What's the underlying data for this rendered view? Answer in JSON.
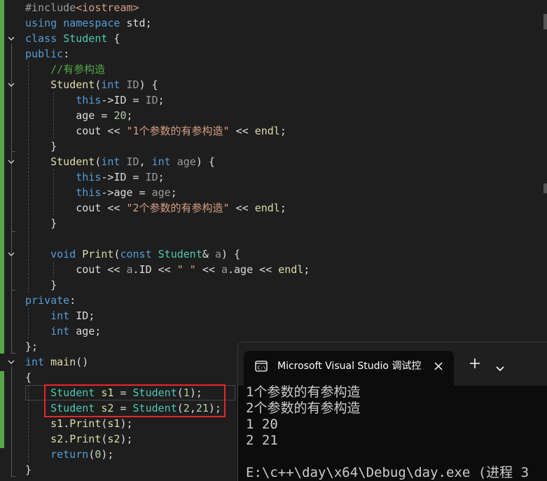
{
  "editor": {
    "lines": [
      [
        {
          "t": "#include",
          "c": "pp"
        },
        {
          "t": "<iostream>",
          "c": "st"
        }
      ],
      [
        {
          "t": "using",
          "c": "kw"
        },
        {
          "t": " ",
          "c": ""
        },
        {
          "t": "namespace",
          "c": "kw"
        },
        {
          "t": " std;",
          "c": ""
        }
      ],
      [
        {
          "t": "class",
          "c": "kw"
        },
        {
          "t": " ",
          "c": ""
        },
        {
          "t": "Student",
          "c": "ty"
        },
        {
          "t": " {",
          "c": ""
        }
      ],
      [
        {
          "t": "public",
          "c": "kw"
        },
        {
          "t": ":",
          "c": ""
        }
      ],
      [
        {
          "t": "    ",
          "c": ""
        },
        {
          "t": "//有参构造",
          "c": "cm"
        }
      ],
      [
        {
          "t": "    ",
          "c": ""
        },
        {
          "t": "Student",
          "c": "fn"
        },
        {
          "t": "(",
          "c": ""
        },
        {
          "t": "int",
          "c": "kw"
        },
        {
          "t": " ",
          "c": ""
        },
        {
          "t": "ID",
          "c": "pa"
        },
        {
          "t": ") {",
          "c": ""
        }
      ],
      [
        {
          "t": "        ",
          "c": ""
        },
        {
          "t": "this",
          "c": "kw"
        },
        {
          "t": "->",
          "c": ""
        },
        {
          "t": "ID",
          "c": "mb"
        },
        {
          "t": " = ",
          "c": ""
        },
        {
          "t": "ID",
          "c": "pa"
        },
        {
          "t": ";",
          "c": ""
        }
      ],
      [
        {
          "t": "        ",
          "c": ""
        },
        {
          "t": "age",
          "c": "mb"
        },
        {
          "t": " = ",
          "c": ""
        },
        {
          "t": "20",
          "c": "nm"
        },
        {
          "t": ";",
          "c": ""
        }
      ],
      [
        {
          "t": "        cout << ",
          "c": ""
        },
        {
          "t": "\"1个参数的有参构造\"",
          "c": "st"
        },
        {
          "t": " << ",
          "c": ""
        },
        {
          "t": "endl",
          "c": "fn"
        },
        {
          "t": ";",
          "c": ""
        }
      ],
      [
        {
          "t": "    }",
          "c": ""
        }
      ],
      [
        {
          "t": "    ",
          "c": ""
        },
        {
          "t": "Student",
          "c": "fn"
        },
        {
          "t": "(",
          "c": ""
        },
        {
          "t": "int",
          "c": "kw"
        },
        {
          "t": " ",
          "c": ""
        },
        {
          "t": "ID",
          "c": "pa"
        },
        {
          "t": ", ",
          "c": ""
        },
        {
          "t": "int",
          "c": "kw"
        },
        {
          "t": " ",
          "c": ""
        },
        {
          "t": "age",
          "c": "pa"
        },
        {
          "t": ") {",
          "c": ""
        }
      ],
      [
        {
          "t": "        ",
          "c": ""
        },
        {
          "t": "this",
          "c": "kw"
        },
        {
          "t": "->",
          "c": ""
        },
        {
          "t": "ID",
          "c": "mb"
        },
        {
          "t": " = ",
          "c": ""
        },
        {
          "t": "ID",
          "c": "pa"
        },
        {
          "t": ";",
          "c": ""
        }
      ],
      [
        {
          "t": "        ",
          "c": ""
        },
        {
          "t": "this",
          "c": "kw"
        },
        {
          "t": "->",
          "c": ""
        },
        {
          "t": "age",
          "c": "mb"
        },
        {
          "t": " = ",
          "c": ""
        },
        {
          "t": "age",
          "c": "pa"
        },
        {
          "t": ";",
          "c": ""
        }
      ],
      [
        {
          "t": "        cout << ",
          "c": ""
        },
        {
          "t": "\"2个参数的有参构造\"",
          "c": "st"
        },
        {
          "t": " << ",
          "c": ""
        },
        {
          "t": "endl",
          "c": "fn"
        },
        {
          "t": ";",
          "c": ""
        }
      ],
      [
        {
          "t": "    }",
          "c": ""
        }
      ],
      [
        {
          "t": "",
          "c": ""
        }
      ],
      [
        {
          "t": "    ",
          "c": ""
        },
        {
          "t": "void",
          "c": "kw"
        },
        {
          "t": " ",
          "c": ""
        },
        {
          "t": "Print",
          "c": "fn"
        },
        {
          "t": "(",
          "c": ""
        },
        {
          "t": "const",
          "c": "kw"
        },
        {
          "t": " ",
          "c": ""
        },
        {
          "t": "Student",
          "c": "ty"
        },
        {
          "t": "& ",
          "c": ""
        },
        {
          "t": "a",
          "c": "pa"
        },
        {
          "t": ") {",
          "c": ""
        }
      ],
      [
        {
          "t": "        cout << ",
          "c": ""
        },
        {
          "t": "a",
          "c": "pa"
        },
        {
          "t": ".",
          "c": ""
        },
        {
          "t": "ID",
          "c": "mb"
        },
        {
          "t": " << ",
          "c": ""
        },
        {
          "t": "\" \"",
          "c": "st"
        },
        {
          "t": " << ",
          "c": ""
        },
        {
          "t": "a",
          "c": "pa"
        },
        {
          "t": ".",
          "c": ""
        },
        {
          "t": "age",
          "c": "mb"
        },
        {
          "t": " << ",
          "c": ""
        },
        {
          "t": "endl",
          "c": "fn"
        },
        {
          "t": ";",
          "c": ""
        }
      ],
      [
        {
          "t": "    }",
          "c": ""
        }
      ],
      [
        {
          "t": "private",
          "c": "kw"
        },
        {
          "t": ":",
          "c": ""
        }
      ],
      [
        {
          "t": "    ",
          "c": ""
        },
        {
          "t": "int",
          "c": "kw"
        },
        {
          "t": " ",
          "c": ""
        },
        {
          "t": "ID",
          "c": "mb"
        },
        {
          "t": ";",
          "c": ""
        }
      ],
      [
        {
          "t": "    ",
          "c": ""
        },
        {
          "t": "int",
          "c": "kw"
        },
        {
          "t": " ",
          "c": ""
        },
        {
          "t": "age",
          "c": "mb"
        },
        {
          "t": ";",
          "c": ""
        }
      ],
      [
        {
          "t": "};",
          "c": ""
        }
      ],
      [
        {
          "t": "int",
          "c": "kw"
        },
        {
          "t": " ",
          "c": ""
        },
        {
          "t": "main",
          "c": "fn"
        },
        {
          "t": "()",
          "c": ""
        }
      ],
      [
        {
          "t": "{",
          "c": ""
        }
      ],
      [
        {
          "t": "    ",
          "c": ""
        },
        {
          "t": "Student",
          "c": "ty"
        },
        {
          "t": " ",
          "c": ""
        },
        {
          "t": "s1",
          "c": "fn"
        },
        {
          "t": " = ",
          "c": ""
        },
        {
          "t": "Student",
          "c": "ty"
        },
        {
          "t": "(",
          "c": ""
        },
        {
          "t": "1",
          "c": "nm"
        },
        {
          "t": ");",
          "c": ""
        }
      ],
      [
        {
          "t": "    ",
          "c": ""
        },
        {
          "t": "Student",
          "c": "ty"
        },
        {
          "t": " ",
          "c": ""
        },
        {
          "t": "s2",
          "c": "fn"
        },
        {
          "t": " = ",
          "c": ""
        },
        {
          "t": "Student",
          "c": "ty"
        },
        {
          "t": "(",
          "c": ""
        },
        {
          "t": "2",
          "c": "nm"
        },
        {
          "t": ",",
          "c": ""
        },
        {
          "t": "21",
          "c": "nm"
        },
        {
          "t": ");",
          "c": ""
        }
      ],
      [
        {
          "t": "    ",
          "c": ""
        },
        {
          "t": "s1",
          "c": "fn"
        },
        {
          "t": ".",
          "c": ""
        },
        {
          "t": "Print",
          "c": "fn"
        },
        {
          "t": "(",
          "c": ""
        },
        {
          "t": "s1",
          "c": "fn"
        },
        {
          "t": ");",
          "c": ""
        }
      ],
      [
        {
          "t": "    ",
          "c": ""
        },
        {
          "t": "s2",
          "c": "fn"
        },
        {
          "t": ".",
          "c": ""
        },
        {
          "t": "Print",
          "c": "fn"
        },
        {
          "t": "(",
          "c": ""
        },
        {
          "t": "s2",
          "c": "fn"
        },
        {
          "t": ");",
          "c": ""
        }
      ],
      [
        {
          "t": "    ",
          "c": ""
        },
        {
          "t": "return",
          "c": "kw"
        },
        {
          "t": "(",
          "c": ""
        },
        {
          "t": "0",
          "c": "nm"
        },
        {
          "t": ");",
          "c": ""
        }
      ],
      [
        {
          "t": "}",
          "c": ""
        }
      ]
    ]
  },
  "terminal": {
    "tab_title": "Microsoft Visual Studio 调试控",
    "tab_icon": "console-icon",
    "close_icon": "close-icon",
    "new_tab_icon": "plus-icon",
    "dropdown_icon": "chevron-down-icon",
    "output": [
      "1个参数的有参构造",
      "2个参数的有参构造",
      "1 20",
      "2 21",
      "",
      "E:\\c++\\day\\x64\\Debug\\day.exe (进程 3"
    ]
  },
  "colors": {
    "editor_bg": "#1e1e1e",
    "keyword": "#569cd6",
    "type": "#4ec9b0",
    "function": "#dcdcaa",
    "comment": "#57a64a",
    "string": "#d69d85",
    "number": "#b5cea8",
    "highlight_box": "#e8262d",
    "terminal_bg": "#0c0c0c"
  }
}
